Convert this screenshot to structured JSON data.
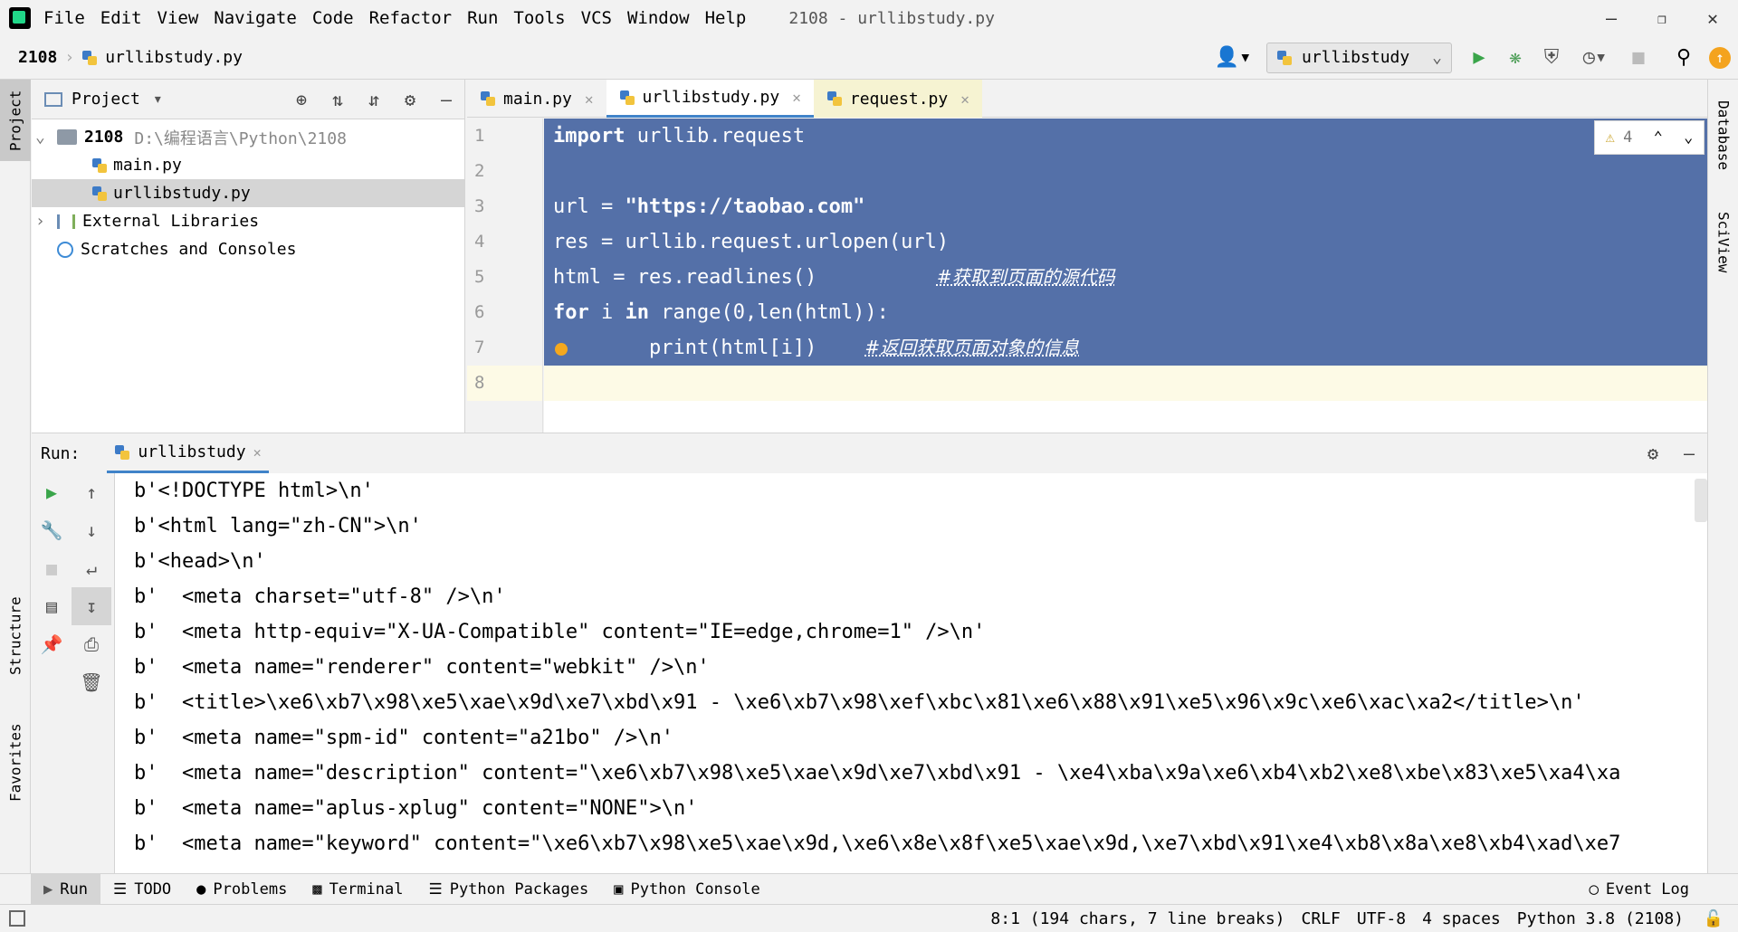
{
  "menubar": {
    "items": [
      "File",
      "Edit",
      "View",
      "Navigate",
      "Code",
      "Refactor",
      "Run",
      "Tools",
      "VCS",
      "Window",
      "Help"
    ],
    "title": "2108 - urllibstudy.py"
  },
  "navbar": {
    "project": "2108",
    "file": "urllibstudy.py",
    "run_config": "urllibstudy"
  },
  "left_stripe": {
    "project": "Project",
    "structure": "Structure",
    "favorites": "Favorites"
  },
  "right_stripe": {
    "database": "Database",
    "sciview": "SciView"
  },
  "project_panel": {
    "title": "Project",
    "root_name": "2108",
    "root_path": "D:\\编程语言\\Python\\2108",
    "files": [
      "main.py",
      "urllibstudy.py"
    ],
    "external": "External Libraries",
    "scratches": "Scratches and Consoles"
  },
  "editor": {
    "tabs": [
      "main.py",
      "urllibstudy.py",
      "request.py"
    ],
    "warnings": "4",
    "line_numbers": [
      "1",
      "2",
      "3",
      "4",
      "5",
      "6",
      "7",
      "8"
    ],
    "lines": {
      "l1a": "import",
      "l1b": " urllib.request",
      "l3a": "url = ",
      "l3b": "\"https://taobao.com\"",
      "l4": "res = urllib.request.urlopen(url)",
      "l5a": "html = res.readlines()          ",
      "l5b": "#获取到页面的源代码",
      "l6a": "for",
      "l6b": " i ",
      "l6c": "in",
      "l6d": " range(0,len(html)):",
      "l7a": "        print(html[i])    ",
      "l7b": "#返回获取页面对象的信息"
    }
  },
  "run": {
    "label": "Run:",
    "tab": "urllibstudy",
    "output": [
      "b'<!DOCTYPE html>\\n'",
      "b'<html lang=\"zh-CN\">\\n'",
      "b'<head>\\n'",
      "b'  <meta charset=\"utf-8\" />\\n'",
      "b'  <meta http-equiv=\"X-UA-Compatible\" content=\"IE=edge,chrome=1\" />\\n'",
      "b'  <meta name=\"renderer\" content=\"webkit\" />\\n'",
      "b'  <title>\\xe6\\xb7\\x98\\xe5\\xae\\x9d\\xe7\\xbd\\x91 - \\xe6\\xb7\\x98\\xef\\xbc\\x81\\xe6\\x88\\x91\\xe5\\x96\\x9c\\xe6\\xac\\xa2</title>\\n'",
      "b'  <meta name=\"spm-id\" content=\"a21bo\" />\\n'",
      "b'  <meta name=\"description\" content=\"\\xe6\\xb7\\x98\\xe5\\xae\\x9d\\xe7\\xbd\\x91 - \\xe4\\xba\\x9a\\xe6\\xb4\\xb2\\xe8\\xbe\\x83\\xe5\\xa4\\xa",
      "b'  <meta name=\"aplus-xplug\" content=\"NONE\">\\n'",
      "b'  <meta name=\"keyword\" content=\"\\xe6\\xb7\\x98\\xe5\\xae\\x9d,\\xe6\\x8e\\x8f\\xe5\\xae\\x9d,\\xe7\\xbd\\x91\\xe4\\xb8\\x8a\\xe8\\xb4\\xad\\xe7"
    ]
  },
  "bottom_tabs": [
    "Run",
    "TODO",
    "Problems",
    "Terminal",
    "Python Packages",
    "Python Console"
  ],
  "event_log": "Event Log",
  "status": {
    "position": "8:1 (194 chars, 7 line breaks)",
    "line_sep": "CRLF",
    "encoding": "UTF-8",
    "indent": "4 spaces",
    "interpreter": "Python 3.8 (2108)"
  },
  "colors": {
    "selection": "#5470a8",
    "current_line": "#fdfae6",
    "accent": "#4083c9"
  }
}
